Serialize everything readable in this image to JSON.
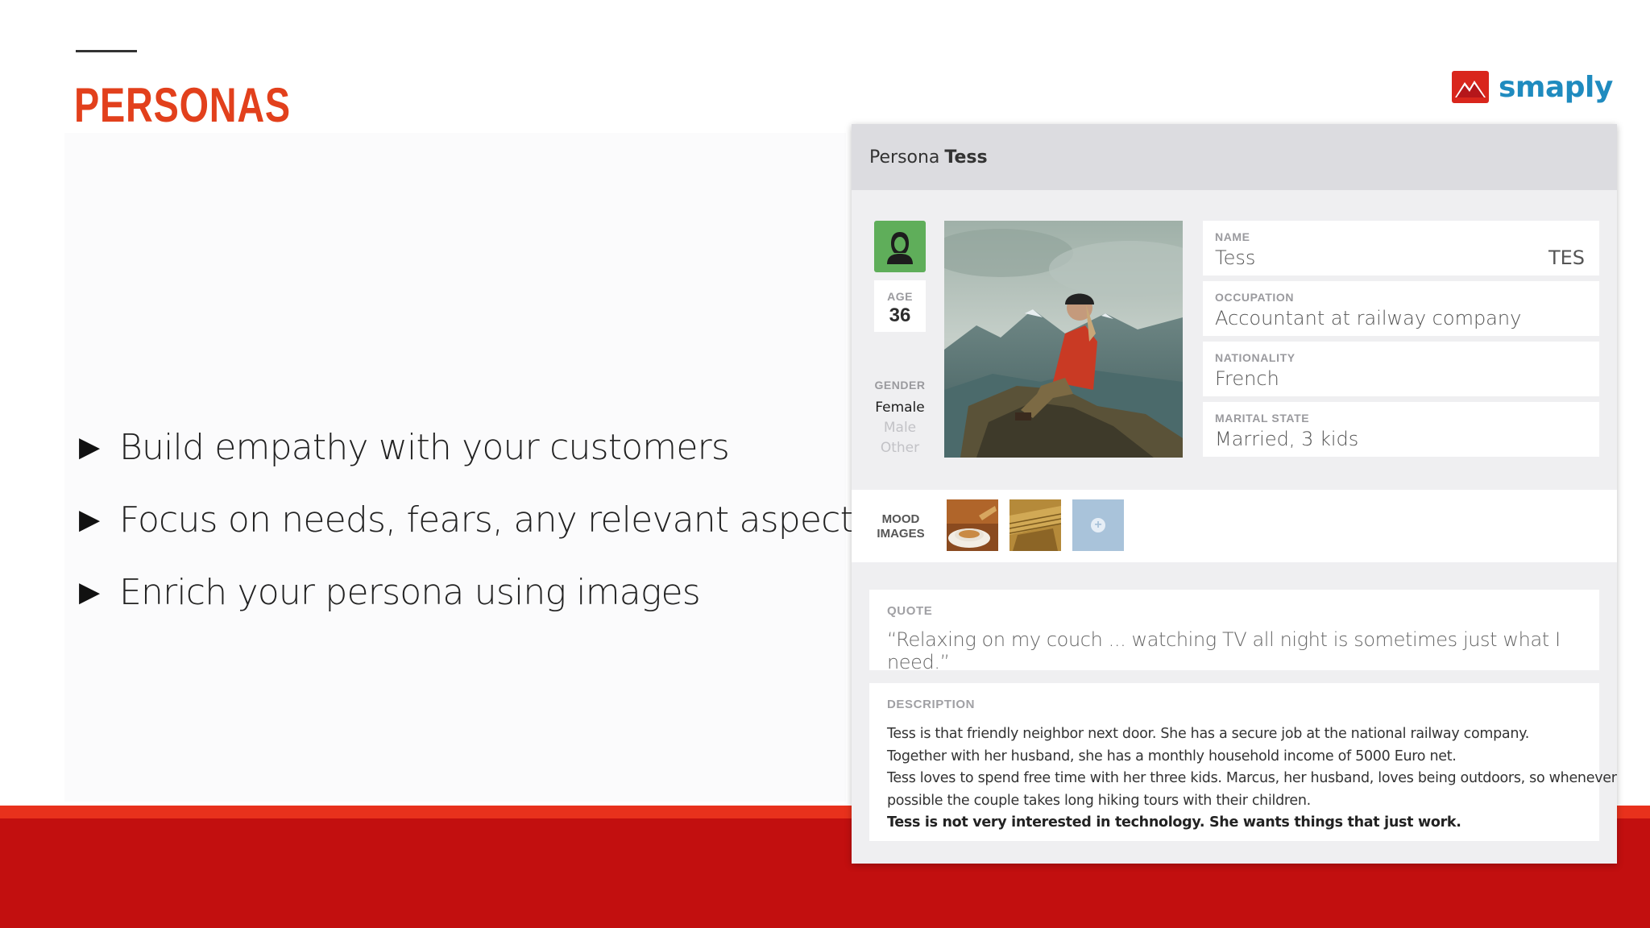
{
  "slide": {
    "title": "PERSONAS",
    "bullets": [
      "Build empathy with your customers",
      "Focus on needs, fears, any relevant aspects",
      "Enrich your persona using images"
    ],
    "bullet_marker": "▶"
  },
  "logo": {
    "text": "smaply",
    "icon": "mountain-logo-icon"
  },
  "colors": {
    "title": "#e2401c",
    "footer_stripe": "#e8311c",
    "footer_band": "#c20f0f",
    "logo_text": "#1f8bbf",
    "avatar_bg": "#5fae5a",
    "mood_add_bg": "#a9c3da"
  },
  "persona": {
    "header_prefix": "Persona",
    "header_name": "Tess",
    "avatar_icon": "person-icon",
    "age_label": "AGE",
    "age_value": "36",
    "gender_label": "GENDER",
    "gender_options": [
      "Female",
      "Male",
      "Other"
    ],
    "gender_selected": "Female",
    "fields": [
      {
        "label": "NAME",
        "value": "Tess",
        "extra": "TES"
      },
      {
        "label": "OCCUPATION",
        "value": "Accountant at railway company"
      },
      {
        "label": "NATIONALITY",
        "value": "French"
      },
      {
        "label": "MARITAL STATE",
        "value": "Married, 3 kids"
      }
    ],
    "mood_label_line1": "MOOD",
    "mood_label_line2": "IMAGES",
    "mood_add_icon": "plus-circle-icon",
    "mood_add_symbol": "+",
    "quote_label": "QUOTE",
    "quote_text": "“Relaxing on my couch ... watching TV all night is sometimes just what I need.”",
    "description_label": "DESCRIPTION",
    "description_lines": [
      "Tess is that friendly neighbor next door. She has a secure job at the national railway company.",
      "Together with her husband, she has a monthly household income of  5000 Euro net.",
      "Tess loves to spend free time with her three kids. Marcus, her husband, loves being outdoors, so whenever",
      "possible the couple takes long hiking tours with their children."
    ],
    "description_bold": "Tess is not very interested in technology. She wants things that just work."
  }
}
